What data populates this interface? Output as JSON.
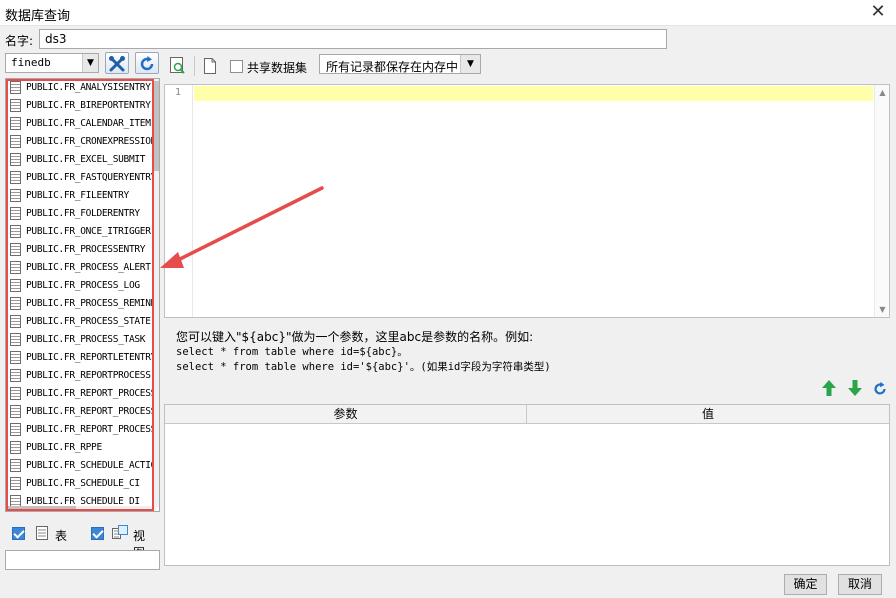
{
  "window": {
    "title": "数据库查询",
    "close_label": "✕"
  },
  "name_field": {
    "label": "名字:",
    "value": "ds3"
  },
  "datasource": {
    "selected": "finedb"
  },
  "tables": [
    "PUBLIC.FR_ANALYSISENTRY",
    "PUBLIC.FR_BIREPORTENTRY",
    "PUBLIC.FR_CALENDAR_ITEM",
    "PUBLIC.FR_CRONEXPRESSION",
    "PUBLIC.FR_EXCEL_SUBMIT",
    "PUBLIC.FR_FASTQUERYENTRY",
    "PUBLIC.FR_FILEENTRY",
    "PUBLIC.FR_FOLDERENTRY",
    "PUBLIC.FR_ONCE_ITRIGGER",
    "PUBLIC.FR_PROCESSENTRY",
    "PUBLIC.FR_PROCESS_ALERT",
    "PUBLIC.FR_PROCESS_LOG",
    "PUBLIC.FR_PROCESS_REMIND",
    "PUBLIC.FR_PROCESS_STATE",
    "PUBLIC.FR_PROCESS_TASK",
    "PUBLIC.FR_REPORTLETENTRY",
    "PUBLIC.FR_REPORTPROCESS",
    "PUBLIC.FR_REPORT_PROCESS",
    "PUBLIC.FR_REPORT_PROCESS_LOG",
    "PUBLIC.FR_REPORT_PROCESS_TASK",
    "PUBLIC.FR_RPPE",
    "PUBLIC.FR_SCHEDULE_ACTION",
    "PUBLIC.FR_SCHEDULE_CI",
    "PUBLIC.FR_SCHEDULE_DI"
  ],
  "filters": {
    "table_label": "表",
    "view_label": "视图"
  },
  "toolbar": {
    "share_label": "共享数据集",
    "memory_option": "所有记录都保存在内存中"
  },
  "editor": {
    "line_number": "1"
  },
  "hint": {
    "line1": "您可以键入\"${abc}\"做为一个参数，这里abc是参数的名称。例如:",
    "line2": "select * from table where id=${abc}。",
    "line3": "select * from table where id='${abc}'。(如果id字段为字符串类型)"
  },
  "params": {
    "col_param": "参数",
    "col_value": "值"
  },
  "buttons": {
    "ok": "确定",
    "cancel": "取消"
  },
  "colors": {
    "highlight": "#e74c4c",
    "accent": "#3b86d8",
    "green_arrow": "#2aa54a",
    "refresh": "#1f6fc7"
  }
}
